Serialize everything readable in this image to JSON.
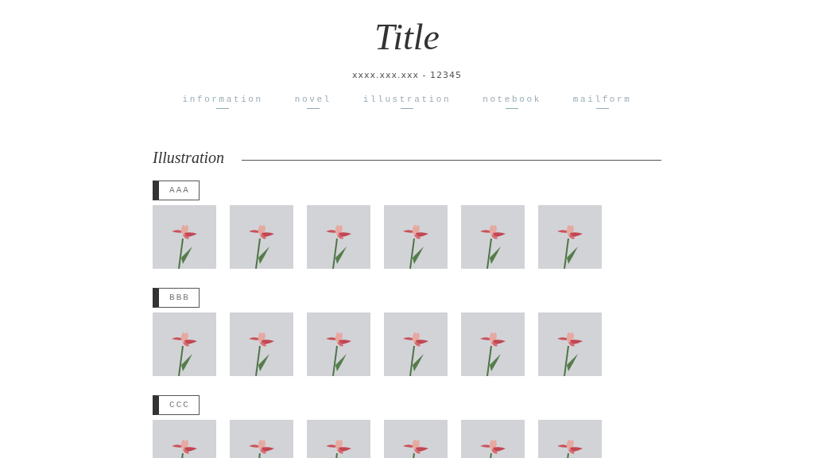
{
  "site": {
    "title": "Title",
    "subtitle": "xxxx.xxx.xxx - 12345"
  },
  "nav": [
    {
      "label": "information"
    },
    {
      "label": "novel"
    },
    {
      "label": "illustration"
    },
    {
      "label": "notebook"
    },
    {
      "label": "mailform"
    }
  ],
  "section": {
    "heading": "Illustration",
    "galleries": [
      {
        "label": "AAA"
      },
      {
        "label": "BBB"
      },
      {
        "label": "CCC"
      }
    ]
  }
}
